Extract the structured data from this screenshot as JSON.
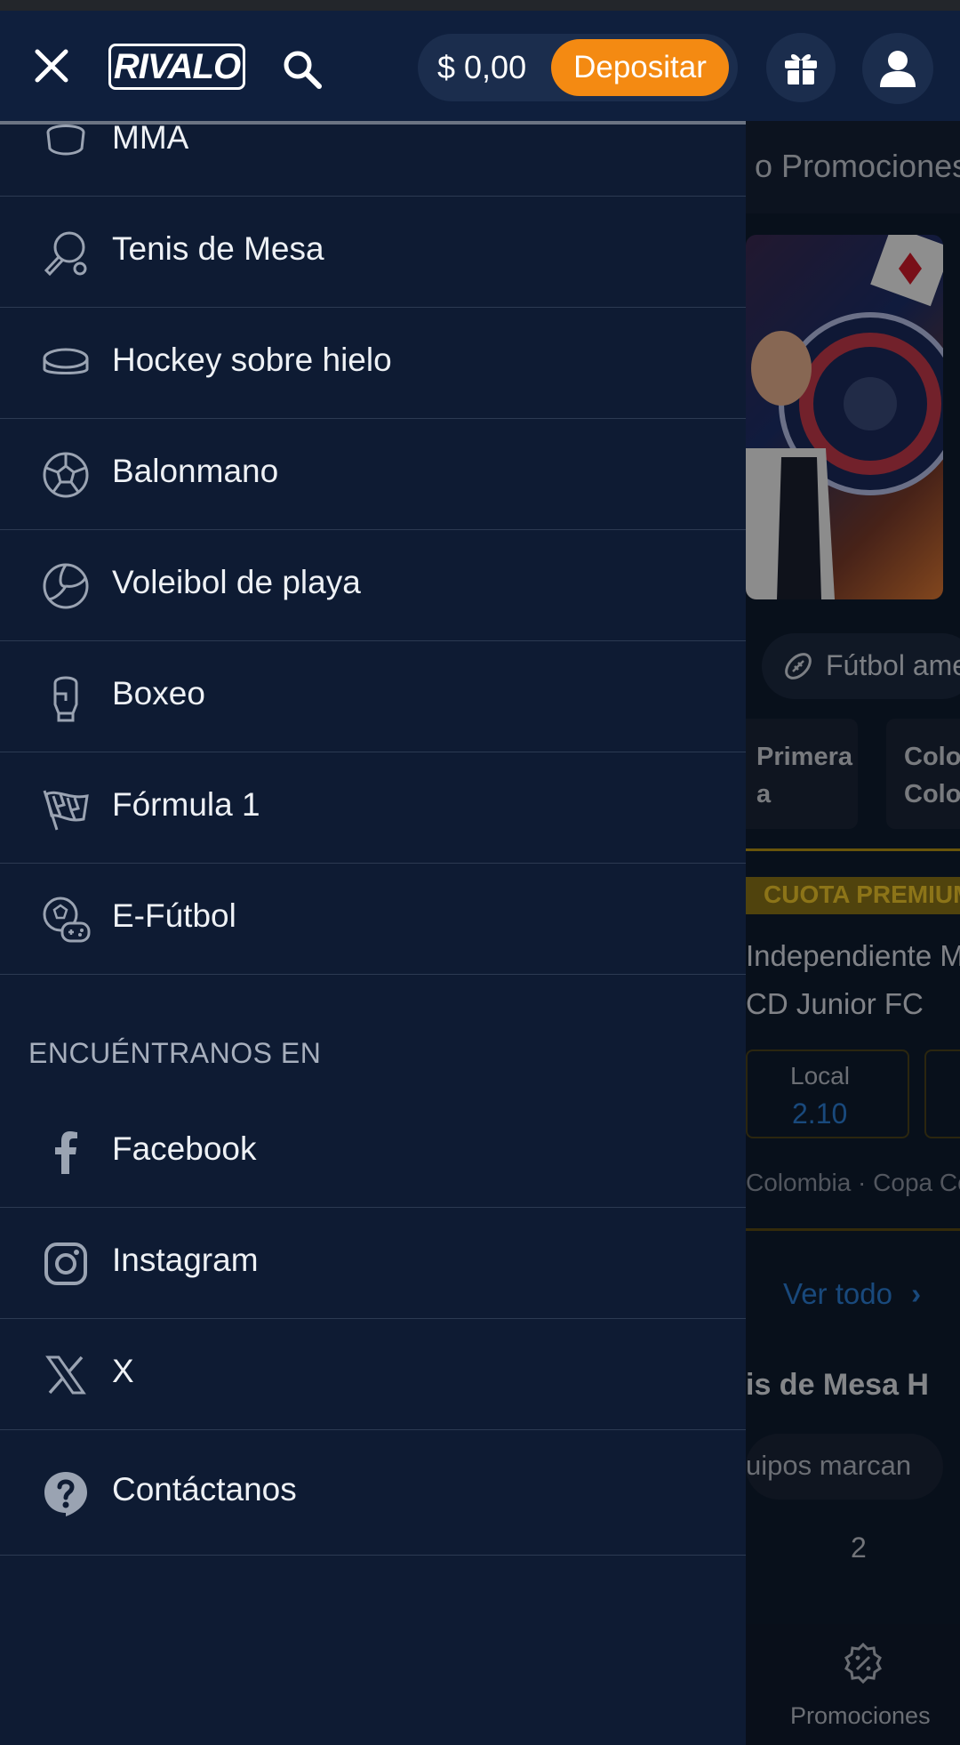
{
  "header": {
    "logo": "RIVALO",
    "balance": "$ 0,00",
    "deposit_label": "Depositar"
  },
  "drawer": {
    "sports": [
      {
        "label": "MMA",
        "icon": "mma-glove-icon"
      },
      {
        "label": "Tenis de Mesa",
        "icon": "table-tennis-icon"
      },
      {
        "label": "Hockey sobre hielo",
        "icon": "hockey-puck-icon"
      },
      {
        "label": "Balonmano",
        "icon": "handball-icon"
      },
      {
        "label": "Voleibol de playa",
        "icon": "volleyball-icon"
      },
      {
        "label": "Boxeo",
        "icon": "boxing-glove-icon"
      },
      {
        "label": "Fórmula 1",
        "icon": "checkered-flag-icon"
      },
      {
        "label": "E-Fútbol",
        "icon": "esports-football-icon"
      }
    ],
    "social_title": "ENCUÉNTRANOS EN",
    "social": [
      {
        "label": "Facebook",
        "icon": "facebook-icon"
      },
      {
        "label": "Instagram",
        "icon": "instagram-icon"
      },
      {
        "label": "X",
        "icon": "x-icon"
      }
    ],
    "contact_label": "Contáctanos"
  },
  "background": {
    "nav_text": "o   Promociones",
    "sport_pill": "Fútbol americano",
    "cards": [
      "Primera\na",
      "Colo\nColo"
    ],
    "premium_label": "CUOTA PREMIUM",
    "team1": "Independiente M",
    "team2": "CD Junior FC",
    "odd_label": "Local",
    "odd_value": "2.10",
    "league": "Colombia · Copa Co",
    "view_all": "Ver todo",
    "tab": "is de Mesa   H",
    "chip": "uipos marcan",
    "number": "2",
    "bottom_nav_label": "Promociones"
  },
  "colors": {
    "drawer_bg": "#0e1b33",
    "header_bg": "#0f1f3d",
    "deposit": "#f48a12",
    "link_blue": "#2b7fd6",
    "premium_gold": "#f1c82a"
  }
}
